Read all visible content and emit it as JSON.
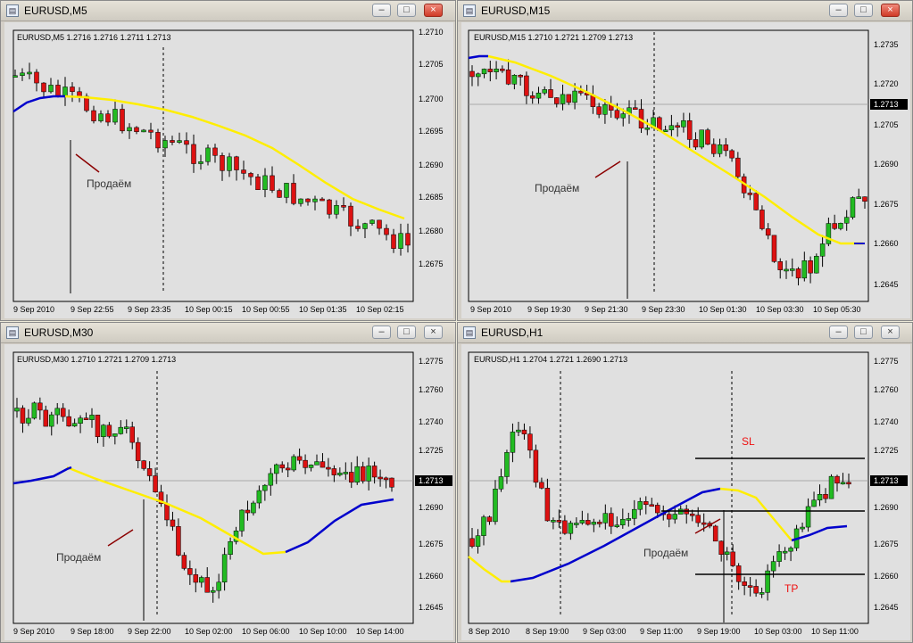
{
  "windows": [
    {
      "title": "EURUSD,M5",
      "info": "EURUSD,M5  1.2716 1.2716 1.2711 1.2713",
      "price_ticks": [
        "1.2710",
        "1.2705",
        "1.2700",
        "1.2695",
        "1.2690",
        "1.2685",
        "1.2680",
        "1.2675"
      ],
      "time_ticks": [
        "9 Sep 2010",
        "9 Sep 22:55",
        "9 Sep 23:35",
        "10 Sep 00:15",
        "10 Sep 00:55",
        "10 Sep 01:35",
        "10 Sep 02:15"
      ],
      "annotation": "Продаём",
      "current_price": ""
    },
    {
      "title": "EURUSD,M15",
      "info": "EURUSD,M15  1.2710 1.2721 1.2709 1.2713",
      "price_ticks": [
        "1.2735",
        "1.2720",
        "1.2705",
        "1.2690",
        "1.2675",
        "1.2660",
        "1.2645"
      ],
      "time_ticks": [
        "9 Sep 2010",
        "9 Sep 19:30",
        "9 Sep 21:30",
        "9 Sep 23:30",
        "10 Sep 01:30",
        "10 Sep 03:30",
        "10 Sep 05:30"
      ],
      "annotation": "Продаём",
      "current_price": "1.2713"
    },
    {
      "title": "EURUSD,M30",
      "info": "EURUSD,M30  1.2710 1.2721 1.2709 1.2713",
      "price_ticks": [
        "1.2775",
        "1.2760",
        "1.2740",
        "1.2725",
        "1.2710",
        "1.2690",
        "1.2675",
        "1.2660",
        "1.2645"
      ],
      "time_ticks": [
        "9 Sep 2010",
        "9 Sep 18:00",
        "9 Sep 22:00",
        "10 Sep 02:00",
        "10 Sep 06:00",
        "10 Sep 10:00",
        "10 Sep 14:00"
      ],
      "annotation": "Продаём",
      "current_price": "1.2713"
    },
    {
      "title": "EURUSD,H1",
      "info": "EURUSD,H1  1.2704 1.2721 1.2690 1.2713",
      "price_ticks": [
        "1.2775",
        "1.2760",
        "1.2740",
        "1.2725",
        "1.2710",
        "1.2690",
        "1.2675",
        "1.2660",
        "1.2645"
      ],
      "time_ticks": [
        "8 Sep 2010",
        "8 Sep 19:00",
        "9 Sep 03:00",
        "9 Sep 11:00",
        "9 Sep 19:00",
        "10 Sep 03:00",
        "10 Sep 11:00"
      ],
      "annotation": "Продаём",
      "current_price": "1.2713",
      "sl_label": "SL",
      "tp_label": "TP"
    }
  ],
  "colors": {
    "chart_bg": "#e0e0e0",
    "bull": "#22bb22",
    "bear": "#dd1111",
    "slow_ma": "#ffee00",
    "fast_ma": "#0000cc",
    "arrow": "#8b0000",
    "level_label": "#ee1111"
  }
}
